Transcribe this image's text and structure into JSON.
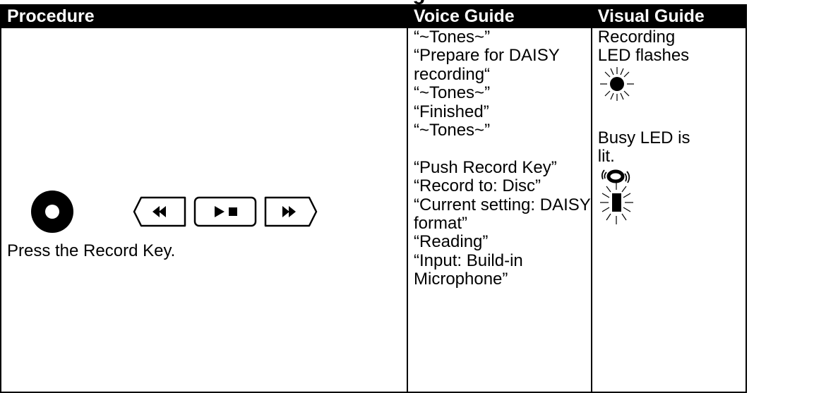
{
  "cutoff_title": "g",
  "table": {
    "headers": [
      "Procedure",
      "Voice Guide",
      "Visual Guide"
    ],
    "procedure_text": "Press the Record Key.",
    "voice_lines": [
      "“~Tones~”",
      "“Prepare for DAISY",
      "recording“",
      "“~Tones~”",
      "“Finished”",
      "“~Tones~”",
      "",
      "“Push Record Key”",
      "“Record to: Disc”",
      "“Current setting: DAISY",
      "format”",
      "“Reading”",
      "“Input: Build-in",
      "Microphone”"
    ],
    "visual": {
      "recording_lines": [
        "Recording",
        "LED flashes"
      ],
      "busy_lines": [
        "Busy LED is",
        "lit."
      ]
    }
  },
  "icons": {
    "record_key": "record-button-icon",
    "rewind_key": "rewind-button-icon",
    "play_stop_key": "play-stop-button-icon",
    "fast_forward_key": "fast-forward-button-icon",
    "recording_led": "flashing-led-icon",
    "busy_led": "busy-led-icon"
  }
}
